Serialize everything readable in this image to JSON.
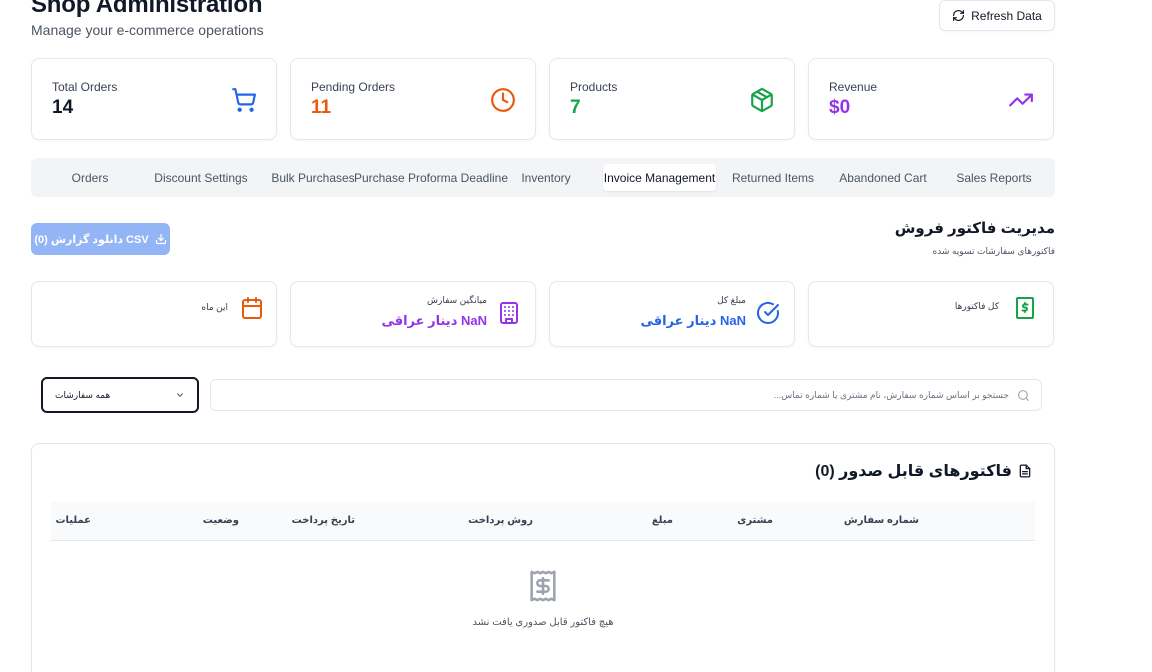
{
  "header": {
    "title": "Shop Administration",
    "subtitle": "Manage your e-commerce operations",
    "refresh_label": "Refresh Data"
  },
  "stats": [
    {
      "label": "Total Orders",
      "value": "14",
      "color": "#111827",
      "icon": "shopping-cart-icon",
      "icon_color": "#2563eb"
    },
    {
      "label": "Pending Orders",
      "value": "11",
      "color": "#ea580c",
      "icon": "clock-icon",
      "icon_color": "#ea580c"
    },
    {
      "label": "Products",
      "value": "7",
      "color": "#16a34a",
      "icon": "package-icon",
      "icon_color": "#16a34a"
    },
    {
      "label": "Revenue",
      "value": "$0",
      "color": "#9333ea",
      "icon": "trending-up-icon",
      "icon_color": "#9333ea"
    }
  ],
  "tabs": [
    {
      "label": "Orders"
    },
    {
      "label": "Discount Settings"
    },
    {
      "label": "Bulk Purchases"
    },
    {
      "label": "Purchase Proforma Deadline"
    },
    {
      "label": "Inventory"
    },
    {
      "label": "Invoice Management",
      "active": true
    },
    {
      "label": "Returned Items"
    },
    {
      "label": "Abandoned Cart"
    },
    {
      "label": "Sales Reports"
    }
  ],
  "invoice": {
    "title": "مدیریت فاکتور فروش",
    "subtitle": "فاکتورهای سفارشات تسویه شده",
    "csv_label": "دانلود گزارش (0) CSV",
    "cards": [
      {
        "label": "کل فاکتورها",
        "value": "",
        "icon": "dollar-document-icon",
        "color": "#16a34a"
      },
      {
        "label": "مبلغ کل",
        "value": "NaN دینار عراقی",
        "icon": "check-circle-icon",
        "color": "#2563eb"
      },
      {
        "label": "میانگین سفارش",
        "value": "NaN دینار عراقی",
        "icon": "building-icon",
        "color": "#9333ea"
      },
      {
        "label": "این ماه",
        "value": "",
        "icon": "calendar-icon",
        "color": "#ea580c"
      }
    ],
    "search_placeholder": "جستجو بر اساس شماره سفارش، نام مشتری یا شماره تماس...",
    "filter_value": "همه سفارشات",
    "table_title": "فاکتورهای قابل صدور (0)",
    "columns": [
      "شماره سفارش",
      "مشتری",
      "مبلغ",
      "روش پرداخت",
      "تاریخ پرداخت",
      "وضعیت",
      "عملیات"
    ],
    "empty_text": "هیچ فاکتور قابل صدوری یافت نشد"
  }
}
